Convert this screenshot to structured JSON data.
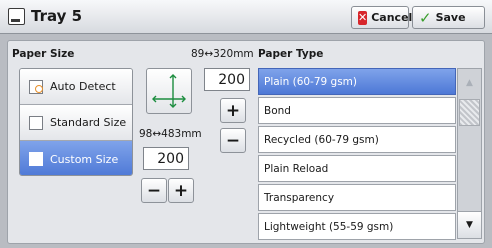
{
  "window": {
    "title": "Tray 5",
    "cancel_label": "Cancel",
    "save_label": "Save"
  },
  "paper_size": {
    "label": "Paper Size",
    "options": [
      {
        "label": "Auto Detect",
        "icon": "auto-detect-icon",
        "selected": false
      },
      {
        "label": "Standard Size",
        "icon": "checkbox-icon",
        "selected": false
      },
      {
        "label": "Custom Size",
        "icon": "checkbox-icon",
        "selected": true
      }
    ],
    "y_range_label": "89↔320mm",
    "y_value": "200",
    "x_range_label": "98↔483mm",
    "x_value": "200",
    "plus_label": "+",
    "minus_label": "−",
    "diagram_x_label": "X",
    "diagram_y_label": "Y"
  },
  "paper_type": {
    "label": "Paper Type",
    "items": [
      {
        "label": "Plain (60-79 gsm)",
        "selected": true
      },
      {
        "label": "Bond",
        "selected": false
      },
      {
        "label": "Recycled (60-79 gsm)",
        "selected": false
      },
      {
        "label": "Plain Reload",
        "selected": false
      },
      {
        "label": "Transparency",
        "selected": false
      },
      {
        "label": "Lightweight (55-59 gsm)",
        "selected": false
      }
    ]
  },
  "colors": {
    "selected": "#5b83de",
    "cancel_icon": "#d7262b",
    "save_icon": "#3a9e2c"
  }
}
